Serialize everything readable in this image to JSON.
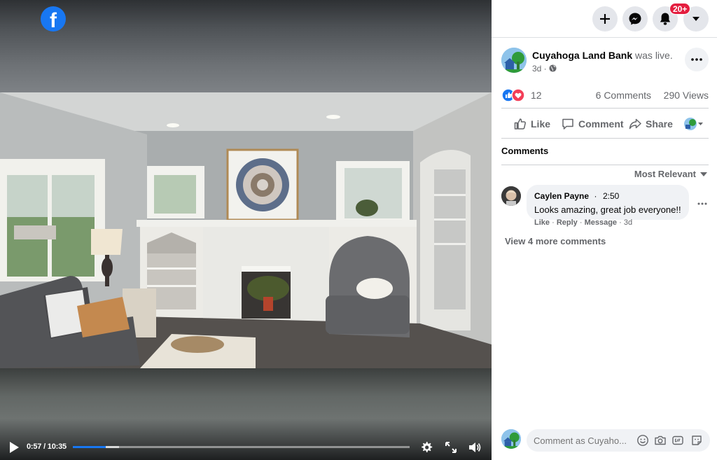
{
  "video": {
    "time_display": "0:57 / 10:35",
    "progress_fraction": 0.098,
    "buffered_fraction": 0.137
  },
  "logo": {
    "glyph": "f",
    "icon": "facebook-logo"
  },
  "nav": {
    "create_icon": "plus-icon",
    "messenger_icon": "messenger-icon",
    "notifications_icon": "bell-icon",
    "notifications_badge": "20+",
    "account_icon": "caret-down-icon"
  },
  "post": {
    "page_name": "Cuyahoga Land Bank",
    "live_text": "was live.",
    "time": "3d ·",
    "reactions_count": "12",
    "comments_count": "6 Comments",
    "views_count": "290 Views",
    "like_label": "Like",
    "comment_label": "Comment",
    "share_label": "Share"
  },
  "comments": {
    "heading": "Comments",
    "sort_label": "Most Relevant",
    "items": [
      {
        "author": "Caylen Payne",
        "time": "2:50",
        "text": "Looks amazing, great job everyone!!",
        "action_like": "Like",
        "action_reply": "Reply",
        "action_message": "Message",
        "age": "3d"
      }
    ],
    "view_more": "View 4 more comments",
    "compose_placeholder": "Comment as Cuyaho..."
  },
  "colors": {
    "brand": "#1877f2",
    "badge": "#e41e3f",
    "secondary_text": "#65676b",
    "bubble_bg": "#f0f2f5"
  }
}
